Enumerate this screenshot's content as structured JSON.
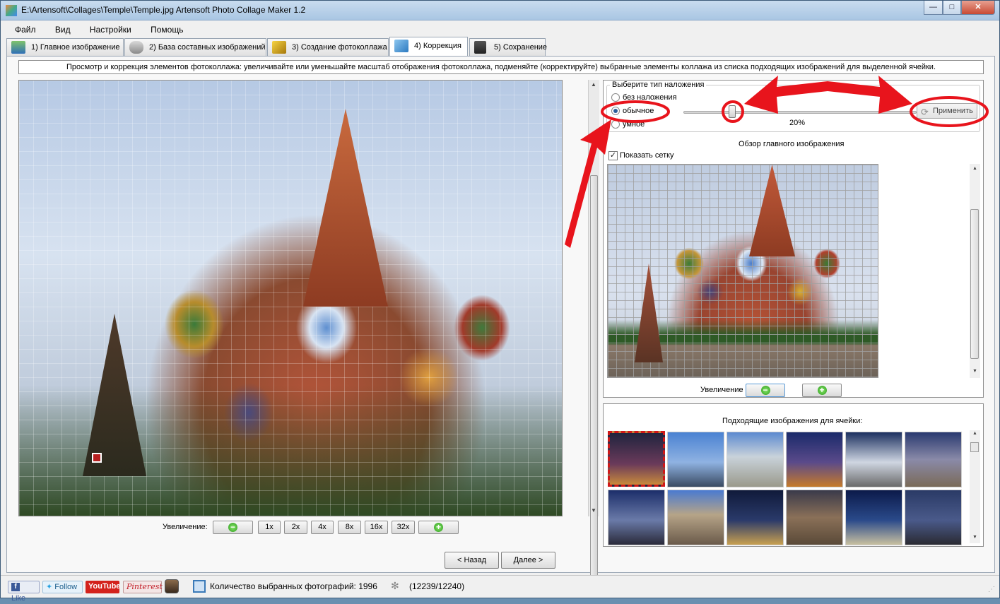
{
  "window": {
    "title": "E:\\Artensoft\\Collages\\Temple\\Temple.jpg Artensoft Photo Collage Maker 1.2",
    "minimize": "—",
    "maximize": "□",
    "close": "✕"
  },
  "menu": [
    "Файл",
    "Вид",
    "Настройки",
    "Помощь"
  ],
  "tabs": [
    {
      "label": "1) Главное изображение",
      "icon": "image-icon"
    },
    {
      "label": "2) База составных изображений",
      "icon": "database-icon"
    },
    {
      "label": "3) Создание фотоколлажа",
      "icon": "magic-wand-icon"
    },
    {
      "label": "4) Коррекция",
      "icon": "cube-icon",
      "active": true
    },
    {
      "label": "5) Сохранение",
      "icon": "floppy-disk-icon"
    }
  ],
  "info_text": "Просмотр и коррекция элементов фотоколлажа: увеличивайте или уменьшайте масштаб отображения фотоколлажа, подменяйте (корректируйте) выбранные элементы коллажа из списка подходящих изображений для выделенной ячейки.",
  "overlay": {
    "group_title": "Выберите тип наложения",
    "options": [
      "без наложения",
      "обычное",
      "умное"
    ],
    "selected": "обычное",
    "slider_value": "20%",
    "slider_fraction": 0.2,
    "apply_label": "Применить"
  },
  "preview": {
    "title": "Обзор главного изображения",
    "show_grid_label": "Показать сетку",
    "show_grid_checked": true,
    "zoom_label": "Увеличение"
  },
  "main_zoom": {
    "label": "Увеличение:",
    "levels": [
      "1x",
      "2x",
      "4x",
      "8x",
      "16x",
      "32x"
    ]
  },
  "matching": {
    "title": "Подходящие изображения для ячейки:"
  },
  "nav": {
    "back": "< Назад",
    "next": "Далее >"
  },
  "status": {
    "like": "Like",
    "follow": "Follow",
    "youtube": "YouTube",
    "pinterest": "Pinterest",
    "count_label": "Количество выбранных фотографий: 1996",
    "progress": "(12239/12240)"
  },
  "colors": {
    "annotation_red": "#e8141c",
    "selection_red": "#d01818",
    "zoom_green": "#3aa82a"
  }
}
